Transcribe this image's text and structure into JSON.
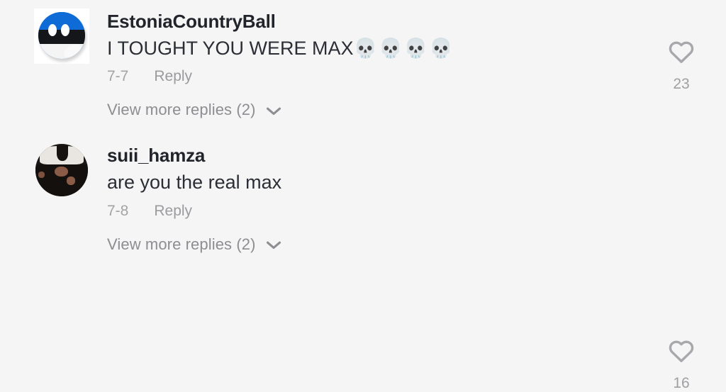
{
  "theme": {
    "background": "#f5f5f5",
    "username_color": "#22242b",
    "text_color": "#2c2e35",
    "muted_color": "#a0a0a4",
    "heart_color": "#a8a8ac"
  },
  "comments": [
    {
      "username": "EstoniaCountryBall",
      "avatar_icon": "estonia-countryball-avatar",
      "text": "I TOUGHT YOU WERE MAX",
      "emojis": "💀💀💀💀",
      "date": "7-7",
      "reply_label": "Reply",
      "like_count": "23",
      "like_icon": "heart-outline-icon",
      "view_more_label": "View more replies (2)",
      "view_more_icon": "chevron-down-icon"
    },
    {
      "username": "suii_hamza",
      "avatar_icon": "user-photo-avatar",
      "text": "are you the real max",
      "emojis": "",
      "date": "7-8",
      "reply_label": "Reply",
      "like_count": "16",
      "like_icon": "heart-outline-icon",
      "view_more_label": "View more replies (2)",
      "view_more_icon": "chevron-down-icon"
    }
  ]
}
